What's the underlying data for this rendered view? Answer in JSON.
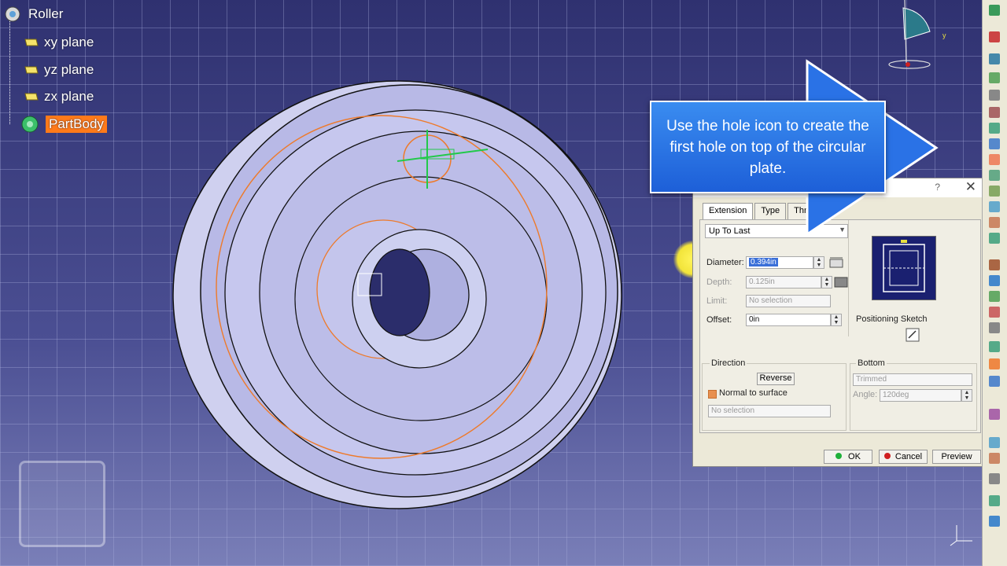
{
  "tree": {
    "root": "Roller",
    "items": [
      {
        "label": "xy plane"
      },
      {
        "label": "yz plane"
      },
      {
        "label": "zx plane"
      },
      {
        "label": "PartBody",
        "selected": true
      }
    ]
  },
  "callout": {
    "text": "Use the hole icon to create the first hole on top of the circular plate."
  },
  "dialog": {
    "help": "?",
    "close": "✕",
    "tabs": [
      "Extension",
      "Type",
      "Thre"
    ],
    "extension_type": "Up To Last",
    "diameter_label": "Diameter:",
    "diameter_value": "0.394in",
    "depth_label": "Depth:",
    "depth_value": "0.125in",
    "limit_label": "Limit:",
    "limit_value": "No selection",
    "offset_label": "Offset:",
    "offset_value": "0in",
    "positioning_sketch": "Positioning Sketch",
    "direction_title": "Direction",
    "reverse": "Reverse",
    "normal_to_surface": "Normal to surface",
    "direction_selection": "No selection",
    "bottom_title": "Bottom",
    "bottom_type": "Trimmed",
    "angle_label": "Angle:",
    "angle_value": "120deg",
    "ok": "OK",
    "cancel": "Cancel",
    "preview": "Preview"
  },
  "colors": {
    "accent_orange": "#ff7a1a",
    "callout_blue": "#1d5fd8",
    "viewport_bg": "#3b3f7d"
  }
}
